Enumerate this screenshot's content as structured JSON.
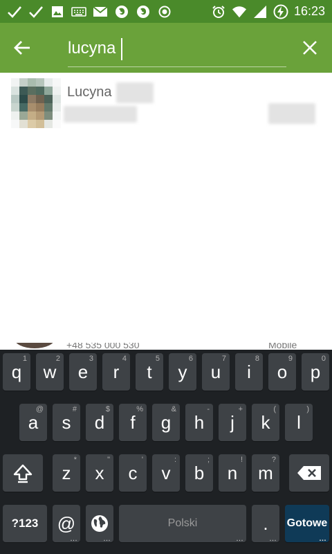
{
  "status_bar": {
    "time": "16:23",
    "left_icons": [
      "check-icon",
      "check-icon",
      "image-icon",
      "keyboard-icon",
      "mail-icon",
      "firefox-icon",
      "firefox-icon",
      "record-icon"
    ],
    "right_icons": [
      "alarm-icon",
      "wifi-icon",
      "signal-icon",
      "battery-charging-icon"
    ]
  },
  "search": {
    "query": "lucyna"
  },
  "results": [
    {
      "name": "Lucyna"
    }
  ],
  "peek_row": {
    "phone": "+48 535 000 530",
    "label": "Mobile"
  },
  "keyboard": {
    "row1": [
      {
        "label": "q",
        "hint": "1"
      },
      {
        "label": "w",
        "hint": "2"
      },
      {
        "label": "e",
        "hint": "3"
      },
      {
        "label": "r",
        "hint": "4"
      },
      {
        "label": "t",
        "hint": "5"
      },
      {
        "label": "y",
        "hint": "6"
      },
      {
        "label": "u",
        "hint": "7"
      },
      {
        "label": "i",
        "hint": "8"
      },
      {
        "label": "o",
        "hint": "9"
      },
      {
        "label": "p",
        "hint": "0"
      }
    ],
    "row2": [
      {
        "label": "a",
        "hint": "@"
      },
      {
        "label": "s",
        "hint": "#"
      },
      {
        "label": "d",
        "hint": "$"
      },
      {
        "label": "f",
        "hint": "%"
      },
      {
        "label": "g",
        "hint": "&"
      },
      {
        "label": "h",
        "hint": "-"
      },
      {
        "label": "j",
        "hint": "+"
      },
      {
        "label": "k",
        "hint": "("
      },
      {
        "label": "l",
        "hint": ")"
      }
    ],
    "row3": [
      {
        "label": "z",
        "hint": "*"
      },
      {
        "label": "x",
        "hint": "\""
      },
      {
        "label": "c",
        "hint": "'"
      },
      {
        "label": "v",
        "hint": ":"
      },
      {
        "label": "b",
        "hint": ";"
      },
      {
        "label": "n",
        "hint": "!"
      },
      {
        "label": "m",
        "hint": "?"
      }
    ],
    "symbols_label": "?123",
    "at_label": "@",
    "space_label": "Polski",
    "period_label": ".",
    "action_label": "Gotowe"
  },
  "colors": {
    "status_bar": "#4a8a2a",
    "app_bar": "#6aa23a",
    "keyboard_bg": "#1e2124",
    "key_bg": "#3e4246",
    "action_key": "#0f3a57"
  }
}
